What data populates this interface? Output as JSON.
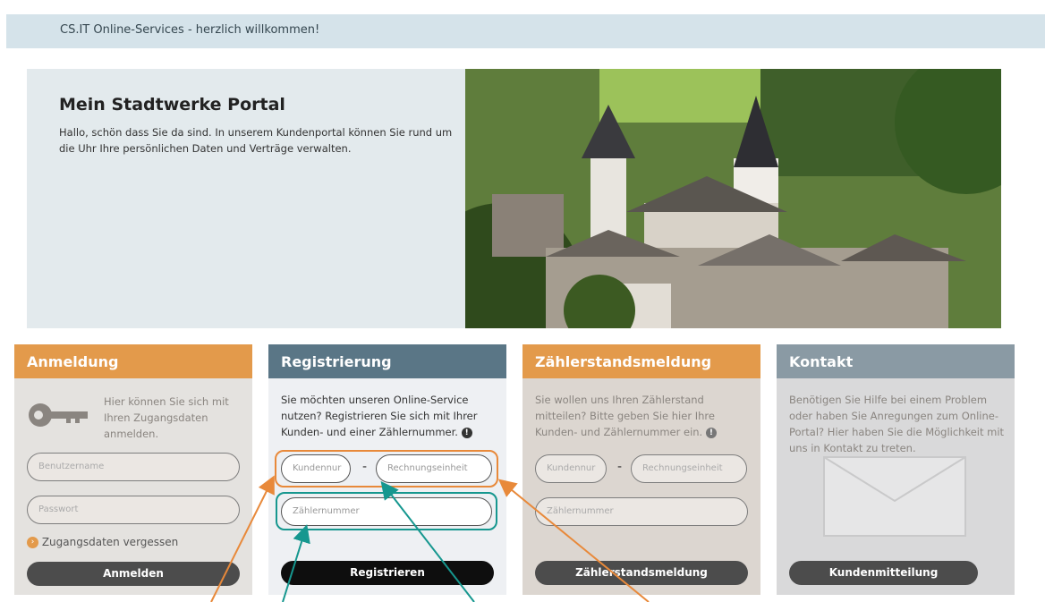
{
  "header": {
    "welcome": "CS.IT Online-Services - herzlich willkommen!"
  },
  "hero": {
    "title": "Mein Stadtwerke Portal",
    "text": "Hallo, schön dass Sie da sind. In unserem Kundenportal können Sie rund um die Uhr Ihre persönlichen Daten und Verträge verwalten."
  },
  "login": {
    "title": "Anmeldung",
    "text": "Hier können Sie sich mit Ihren Zugangsdaten anmelden.",
    "username_placeholder": "Benutzername",
    "password_placeholder": "Passwort",
    "forgot": "Zugangsdaten vergessen",
    "button": "Anmelden"
  },
  "register": {
    "title": "Registrierung",
    "text": "Sie möchten unseren Online-Service nutzen? Registrieren Sie sich mit Ihrer Kunden- und einer Zählernummer.",
    "customer_placeholder": "Kundennur",
    "unit_placeholder": "Rechnungseinheit",
    "meter_placeholder": "Zählernummer",
    "separator": "-",
    "button": "Registrieren"
  },
  "meter": {
    "title": "Zählerstandsmeldung",
    "text": "Sie wollen uns Ihren Zählerstand mitteilen? Bitte geben Sie hier Ihre Kunden- und Zählernummer ein.",
    "customer_placeholder": "Kundennur",
    "unit_placeholder": "Rechnungseinheit",
    "meter_placeholder": "Zählernummer",
    "separator": "-",
    "button": "Zählerstandsmeldung"
  },
  "contact": {
    "title": "Kontakt",
    "text": "Benötigen Sie Hilfe bei einem Problem oder haben Sie Anregungen zum Online-Portal? Hier haben Sie die Möglichkeit mit uns in Kontakt zu treten.",
    "button": "Kundenmitteilung"
  },
  "colors": {
    "orange": "#e39a4b",
    "teal": "#16978f",
    "slate": "#5a7686"
  }
}
